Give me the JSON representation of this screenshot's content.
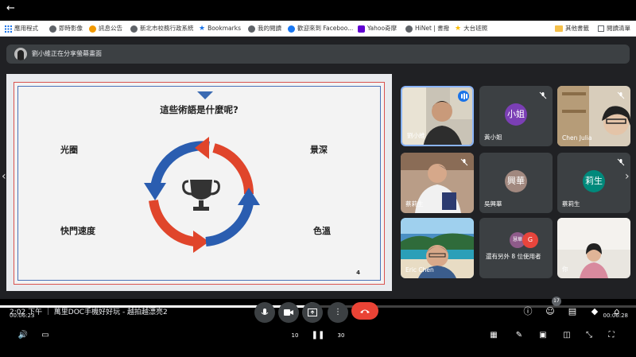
{
  "top": {
    "back_glyph": "←"
  },
  "bookmarks": {
    "apps": "應用程式",
    "items": [
      {
        "label": "即時影像",
        "icon": "globe-icon",
        "color": "#5f6368"
      },
      {
        "label": "訊息公告",
        "icon": "link-icon",
        "color": "#f29900"
      },
      {
        "label": "新北市校務行政系統",
        "icon": "globe-icon",
        "color": "#5f6368"
      },
      {
        "label": "Bookmarks",
        "icon": "star-icon",
        "color": "#1a73e8"
      },
      {
        "label": "我的閱讀",
        "icon": "globe-icon",
        "color": "#5f6368"
      },
      {
        "label": "歡迎來到 Faceboo...",
        "icon": "facebook-icon",
        "color": "#1877f2"
      },
      {
        "label": "Yahoo奇摩",
        "icon": "yahoo-icon",
        "color": "#6001d2"
      },
      {
        "label": "HiNet | 書撥",
        "icon": "globe-icon",
        "color": "#5f6368"
      },
      {
        "label": "大台班照",
        "icon": "star-icon",
        "color": "#fbbc04"
      }
    ],
    "other": "其他書籤",
    "reading_list": "閱讀清單"
  },
  "presenter": {
    "text": "劉小維正在分享螢幕畫面"
  },
  "slide": {
    "title": "這些術語是什麼呢?",
    "terms": {
      "tl": "光圈",
      "tr": "景深",
      "bl": "快門速度",
      "br": "色溫"
    },
    "page": "4",
    "colors": {
      "red": "#e0452b",
      "blue": "#2a5db0"
    }
  },
  "tiles": [
    {
      "name": "劉小維",
      "kind": "video",
      "active": true
    },
    {
      "name": "黃小姐",
      "kind": "avatar",
      "letter": "小姐",
      "color": "#7b3fb5"
    },
    {
      "name": "Chen Julia",
      "kind": "video"
    },
    {
      "name": "蔡莉生",
      "kind": "video"
    },
    {
      "name": "吳興華",
      "kind": "avatar",
      "letter": "興華",
      "color": "#a1887f"
    },
    {
      "name": "蔡莉生",
      "kind": "avatar",
      "letter": "莉生",
      "color": "#00897b"
    },
    {
      "name": "Eric Chen",
      "kind": "video"
    },
    {
      "name": "還有另外 8 位使用者",
      "kind": "more",
      "letters": [
        "慧華",
        "G"
      ]
    },
    {
      "name": "你",
      "kind": "video"
    }
  ],
  "controls": {
    "meeting": "2:02 下午 ｜ 萬里DOC手機好好玩 - 越拍越漂亮2",
    "time_current": "00:06:23",
    "time_total": "00:06:28",
    "progress": 0.49,
    "participants_count": "17",
    "skip_back": "10",
    "skip_forward": "30"
  }
}
